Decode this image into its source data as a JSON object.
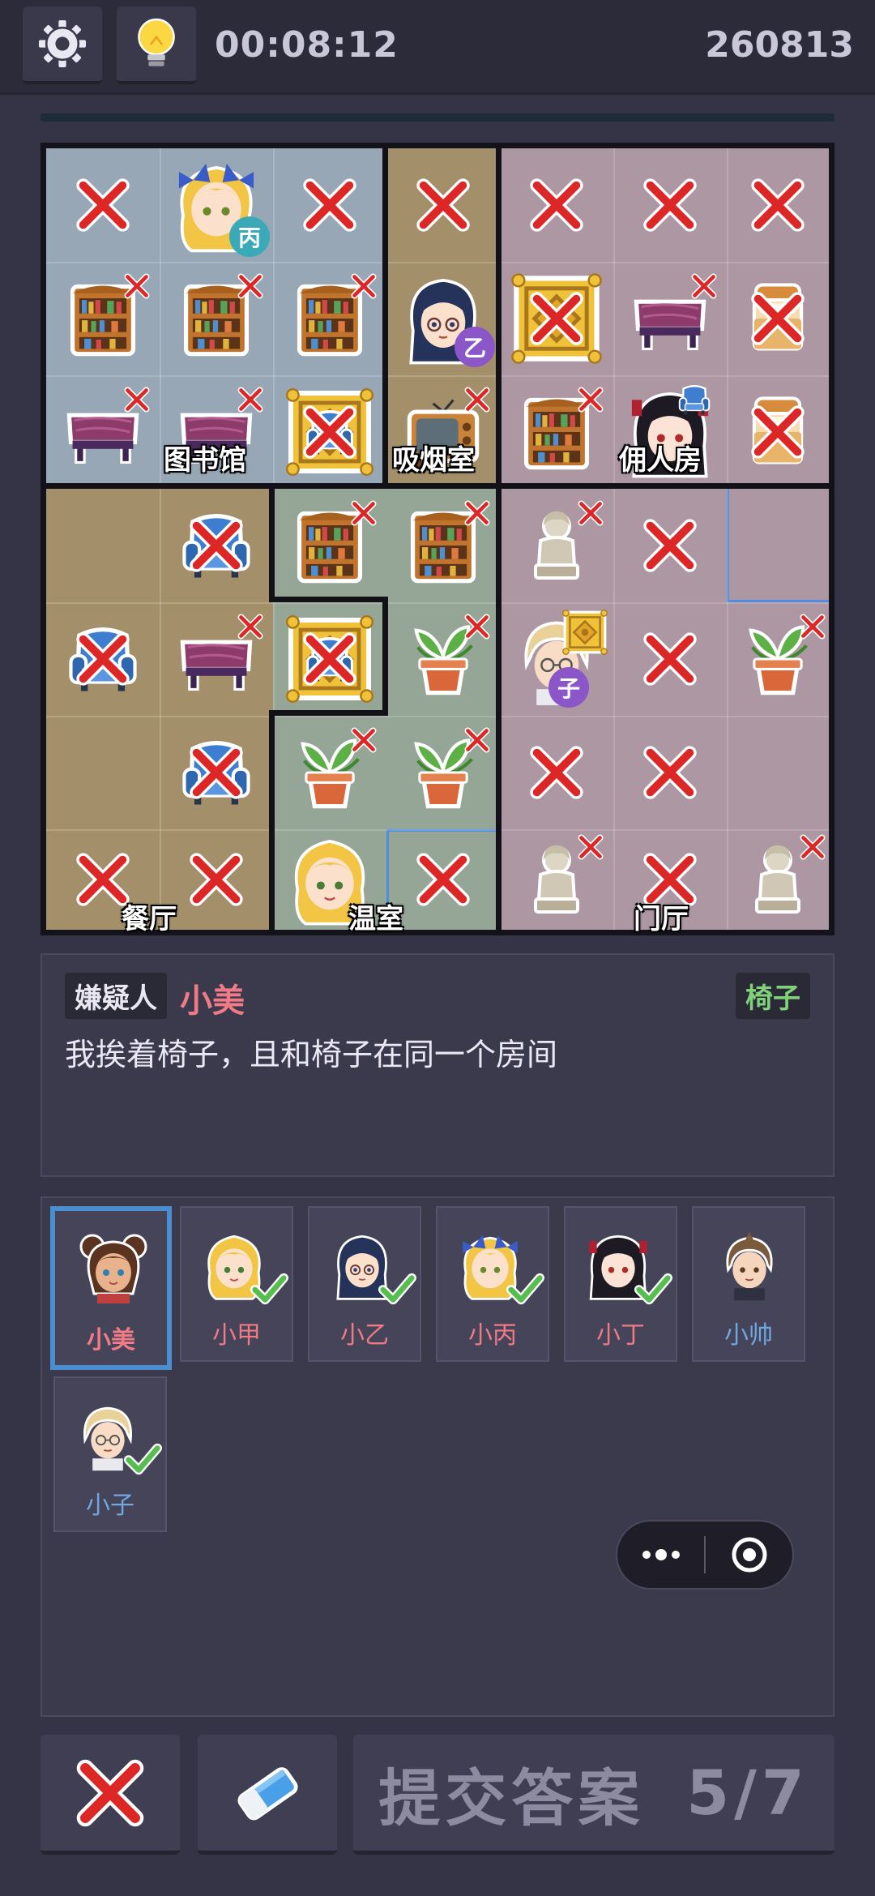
{
  "toolbar": {
    "timer": "00:08:12",
    "score": "260813"
  },
  "rooms": [
    {
      "name": "图书馆"
    },
    {
      "name": "吸烟室"
    },
    {
      "name": "佣人房"
    },
    {
      "name": "餐厅"
    },
    {
      "name": "温室"
    },
    {
      "name": "门厅"
    }
  ],
  "board": {
    "badges": {
      "bing": "丙",
      "yi": "乙",
      "zi": "子"
    }
  },
  "clue": {
    "tag_suspect": "嫌疑人",
    "suspect_name": "小美",
    "object_tag": "椅子",
    "text": "我挨着椅子，且和椅子在同一个房间"
  },
  "characters": [
    {
      "name": "小美",
      "selected": true,
      "checked": false,
      "gender": "female"
    },
    {
      "name": "小甲",
      "selected": false,
      "checked": true,
      "gender": "female"
    },
    {
      "name": "小乙",
      "selected": false,
      "checked": true,
      "gender": "female"
    },
    {
      "name": "小丙",
      "selected": false,
      "checked": true,
      "gender": "female"
    },
    {
      "name": "小丁",
      "selected": false,
      "checked": true,
      "gender": "female"
    },
    {
      "name": "小帅",
      "selected": false,
      "checked": false,
      "gender": "male"
    },
    {
      "name": "小子",
      "selected": false,
      "checked": true,
      "gender": "male"
    }
  ],
  "bottom": {
    "submit_label": "提交答案",
    "progress": "5/7"
  },
  "colors": {
    "female_name": "#f07b86",
    "male_name": "#6fa8e0",
    "check": "#5fc35a",
    "cross": "#e02a2a",
    "select_border": "#4a8ed0"
  }
}
